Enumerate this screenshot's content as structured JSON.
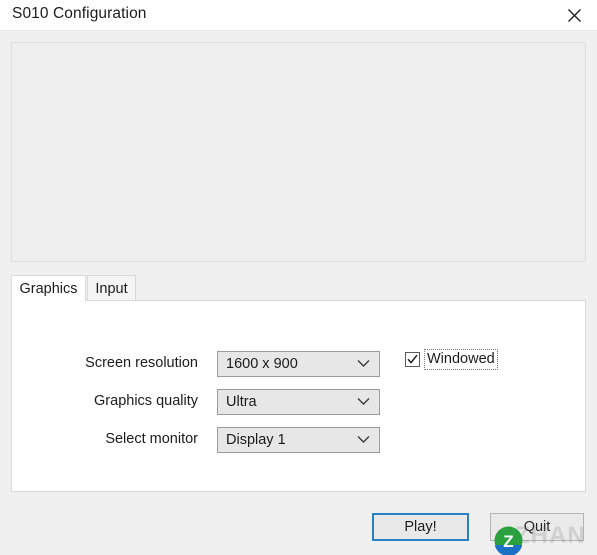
{
  "window": {
    "title": "S010 Configuration",
    "close_icon": "close-icon"
  },
  "banner": {
    "content": ""
  },
  "tabs": [
    {
      "label": "Graphics",
      "active": true
    },
    {
      "label": "Input",
      "active": false
    }
  ],
  "graphics_form": {
    "rows": [
      {
        "label": "Screen resolution",
        "value": "1600 x 900",
        "arrow_icon": "chevron-down-icon"
      },
      {
        "label": "Graphics quality",
        "value": "Ultra",
        "arrow_icon": "chevron-down-icon"
      },
      {
        "label": "Select monitor",
        "value": "Display 1",
        "arrow_icon": "chevron-down-icon"
      }
    ],
    "windowed": {
      "label": "Windowed",
      "checked": true,
      "check_icon": "checkmark-icon"
    }
  },
  "footer": {
    "play_label": "Play!",
    "quit_label": "Quit"
  },
  "watermark": {
    "text": "ZHAN",
    "logo_letter": "Z"
  },
  "colors": {
    "accent_focus": "#2a80c4",
    "window_bg": "#f0f0f0",
    "titlebar_bg": "#ffffff",
    "panel_bg": "#ffffff",
    "dropdown_bg": "#e7e7e7",
    "watermark_green": "#2aa03f",
    "watermark_blue": "#1b72c4"
  }
}
